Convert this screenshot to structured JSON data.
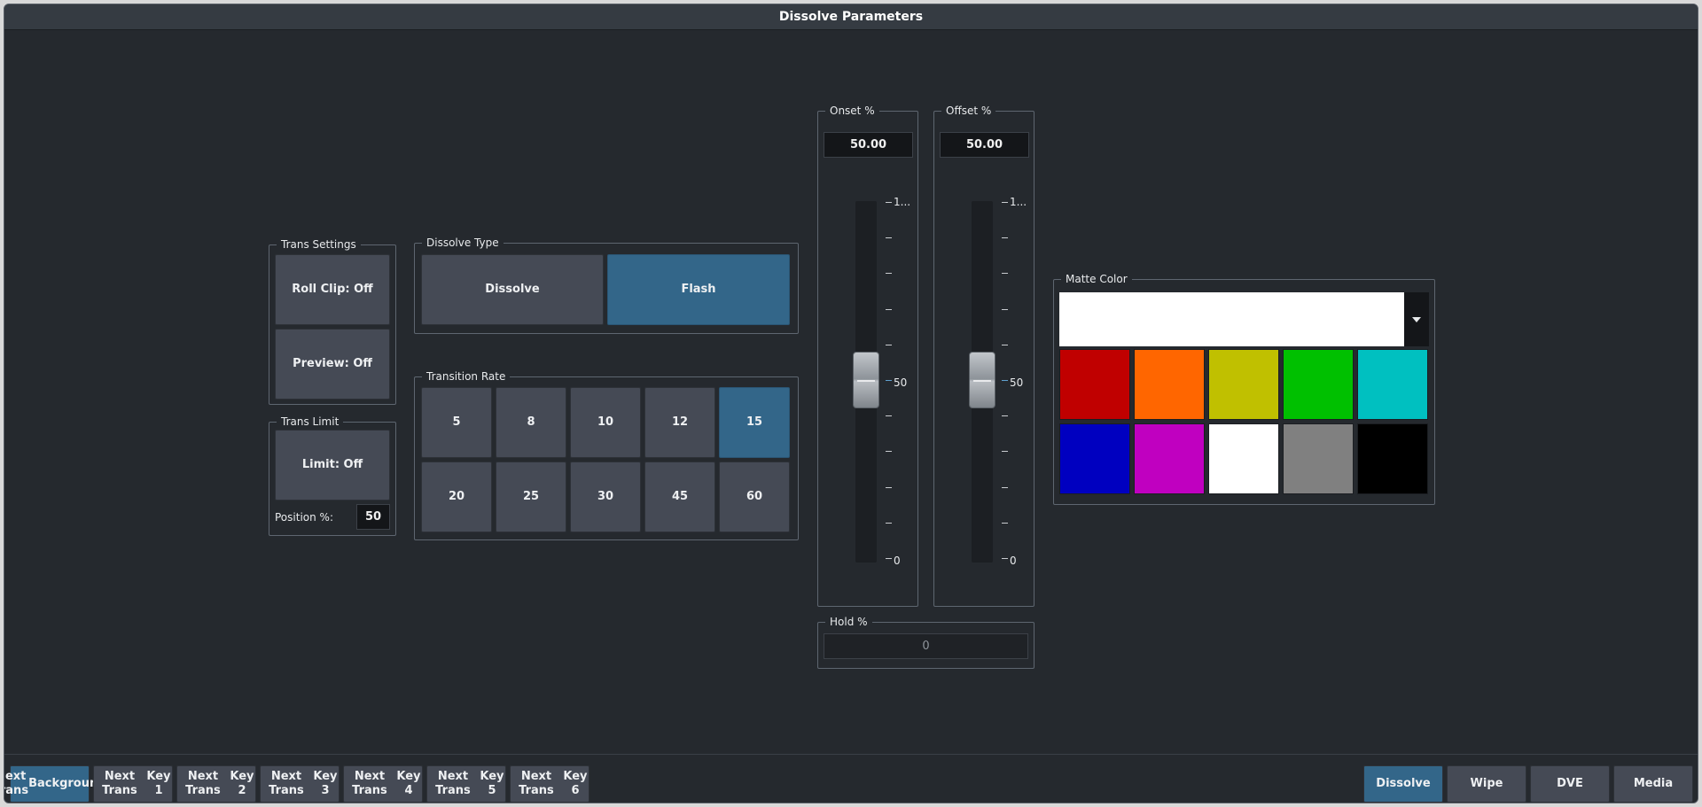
{
  "window": {
    "title": "Dissolve Parameters"
  },
  "trans_settings": {
    "legend": "Trans Settings",
    "roll_clip_label": "Roll Clip: Off",
    "preview_label": "Preview: Off"
  },
  "trans_limit": {
    "legend": "Trans Limit",
    "limit_label": "Limit: Off",
    "position_label": "Position %:",
    "position_value": "50"
  },
  "dissolve_type": {
    "legend": "Dissolve Type",
    "options": [
      "Dissolve",
      "Flash"
    ],
    "selected": "Flash"
  },
  "transition_rate": {
    "legend": "Transition Rate",
    "rates": [
      "5",
      "8",
      "10",
      "12",
      "15",
      "20",
      "25",
      "30",
      "45",
      "60"
    ],
    "selected": "15"
  },
  "onset": {
    "legend": "Onset %",
    "value": "50.00",
    "scale_top": "1...",
    "scale_mid": "50",
    "scale_bottom": "0",
    "level_percent": 50
  },
  "offset": {
    "legend": "Offset %",
    "value": "50.00",
    "scale_top": "1...",
    "scale_mid": "50",
    "scale_bottom": "0",
    "level_percent": 50
  },
  "hold": {
    "legend": "Hold %",
    "value": "0"
  },
  "matte_color": {
    "legend": "Matte Color",
    "current_color": "#ffffff",
    "swatches": [
      "#c00000",
      "#ff6600",
      "#c0c000",
      "#00c000",
      "#00c0c0",
      "#0000c0",
      "#c000c0",
      "#ffffff",
      "#808080",
      "#000000"
    ],
    "dropdown_icon": "caret-down-icon"
  },
  "bottom_bar": {
    "next_trans": [
      {
        "line1": "Next Trans",
        "line2": "Background",
        "active": true
      },
      {
        "line1": "Next Trans",
        "line2": "Key 1",
        "active": false
      },
      {
        "line1": "Next Trans",
        "line2": "Key 2",
        "active": false
      },
      {
        "line1": "Next Trans",
        "line2": "Key 3",
        "active": false
      },
      {
        "line1": "Next Trans",
        "line2": "Key 4",
        "active": false
      },
      {
        "line1": "Next Trans",
        "line2": "Key 5",
        "active": false
      },
      {
        "line1": "Next Trans",
        "line2": "Key 6",
        "active": false
      }
    ],
    "modes": [
      {
        "label": "Dissolve",
        "active": true
      },
      {
        "label": "Wipe",
        "active": false
      },
      {
        "label": "DVE",
        "active": false
      },
      {
        "label": "Media",
        "active": false
      }
    ]
  }
}
